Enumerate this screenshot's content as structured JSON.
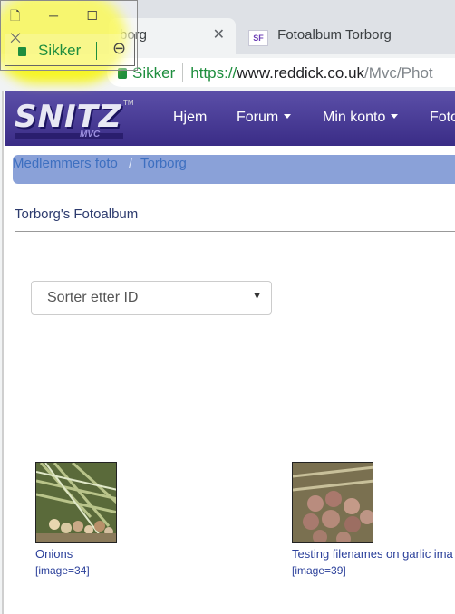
{
  "browser": {
    "active_tab_title": "borg",
    "inactive_tab_title": "Fotoalbum Torborg",
    "inactive_tab_favicon": "SF",
    "close_glyph": "✕",
    "omnibox": {
      "secure_label": "Sikker",
      "url_scheme": "https://",
      "url_host": "www.reddick.co.uk",
      "url_path": "/Mvc/Phot"
    }
  },
  "zoom_popup": {
    "window_buttons": "🗋 ─ ☐ ✕",
    "secure_label": "Sikker",
    "zoom_glyph": "⊖"
  },
  "site": {
    "logo_text": "SNITZ",
    "logo_sub": "MVC",
    "logo_tm": "TM",
    "nav": [
      {
        "label": "Hjem"
      },
      {
        "label": "Forum"
      },
      {
        "label": "Min konto"
      },
      {
        "label": "Foto"
      }
    ],
    "breadcrumb": {
      "parent": "Medlemmers foto",
      "separator": "/",
      "current": "Torborg"
    },
    "album_title": "Torborg's Fotoalbum",
    "sort": {
      "selected": "Sorter etter ID",
      "arrow": "▼"
    },
    "photos": [
      {
        "caption": "Onions",
        "tag": "[image=34]"
      },
      {
        "caption": "Testing filenames on garlic ima",
        "tag": "[image=39]"
      }
    ]
  },
  "colors": {
    "navbar": "#3a2c86",
    "breadcrumb_bg": "#8aa1d8",
    "secure_green": "#1e8e3e",
    "link": "#2a3f9a",
    "highlight": "#f7f600"
  }
}
